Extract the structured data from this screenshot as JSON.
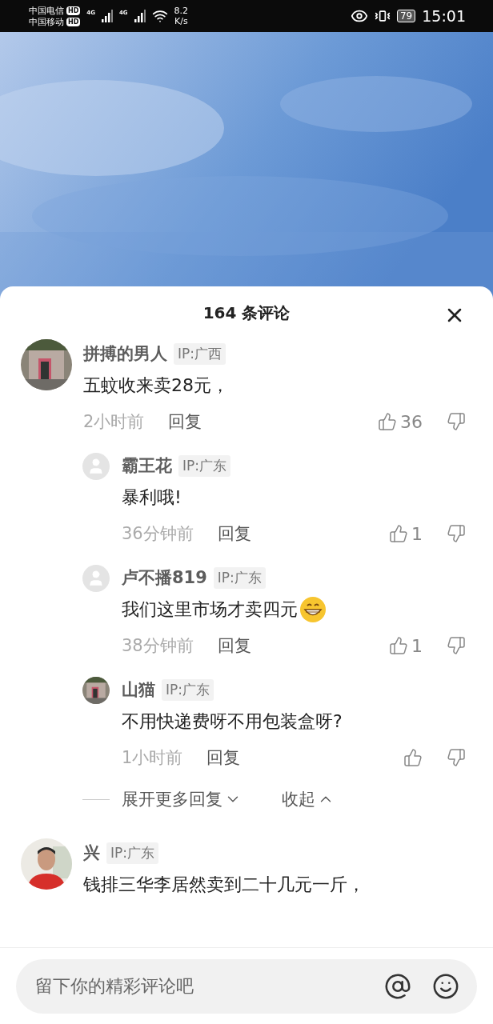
{
  "status_bar": {
    "carriers": [
      {
        "name": "中国电信",
        "badge": "HD"
      },
      {
        "name": "中国移动",
        "badge": "HD"
      }
    ],
    "networks": [
      "4G",
      "4G"
    ],
    "speed": [
      "8.2",
      "K/s"
    ],
    "battery": "79",
    "time": "15:01"
  },
  "sheet": {
    "title": "164 条评论"
  },
  "comments": [
    {
      "author": "拼搏的男人",
      "ip": "IP:广西",
      "text": "五蚊收来卖28元，",
      "emoji": false,
      "time": "2小时前",
      "reply": "回复",
      "likes": "36",
      "replies": [
        {
          "avatar": {
            "kind": "default"
          },
          "author": "霸王花",
          "ip": "IP:广东",
          "text": "暴利哦!",
          "emoji": false,
          "time": "36分钟前",
          "reply": "回复",
          "likes": "1"
        },
        {
          "avatar": {
            "kind": "default"
          },
          "author": "卢不播819",
          "ip": "IP:广东",
          "text": "我们这里市场才卖四元",
          "emoji": true,
          "time": "38分钟前",
          "reply": "回复",
          "likes": "1"
        },
        {
          "author": "山猫",
          "ip": "IP:广东",
          "text": "不用快递费呀不用包装盒呀?",
          "emoji": false,
          "time": "1小时前",
          "reply": "回复"
        }
      ],
      "expand": "展开更多回复",
      "collapse": "收起"
    },
    {
      "avatar": {
        "kind": "person"
      },
      "author": "兴",
      "ip": "IP:广东",
      "text": "钱排三华李居然卖到二十几元一斤，",
      "emoji": false
    }
  ],
  "input": {
    "placeholder": "留下你的精彩评论吧"
  }
}
